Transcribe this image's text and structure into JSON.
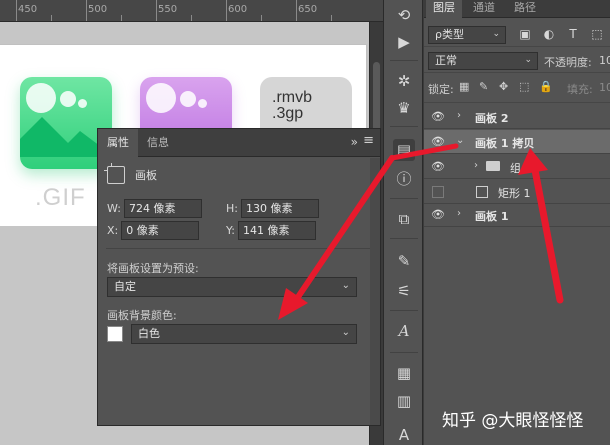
{
  "ruler": {
    "ticks": [
      "450",
      "500",
      "550",
      "600",
      "650"
    ]
  },
  "canvas": {
    "gif_label": ".GIF",
    "rmvb_line1": ".rmvb",
    "rmvb_line2": ".3gp"
  },
  "properties_panel": {
    "tabs": [
      "属性",
      "信息"
    ],
    "collapse_glyph": "»",
    "menu_glyph": "≡",
    "type_label": "画板",
    "fields": {
      "w_label": "W:",
      "w_value": "724 像素",
      "h_label": "H:",
      "h_value": "130 像素",
      "x_label": "X:",
      "x_value": "0 像素",
      "y_label": "Y:",
      "y_value": "141 像素"
    },
    "preset_label": "将画板设置为预设:",
    "preset_value": "自定",
    "bg_color_label": "画板背景颜色:",
    "bg_color_value": "白色",
    "bg_swatch_color": "#ffffff"
  },
  "layers_panel": {
    "tabs": [
      "图层",
      "通道",
      "路径"
    ],
    "filter_select": "ρ类型",
    "blend_mode": "正常",
    "opacity_label": "不透明度:",
    "opacity_value": "10",
    "lock_label": "锁定:",
    "fill_label": "填充:",
    "fill_value": "10",
    "layers": [
      {
        "name": "画板 2",
        "visible": true
      },
      {
        "name": "画板 1 拷贝",
        "visible": true,
        "selected": true
      },
      {
        "name": "组",
        "visible": true
      },
      {
        "name": "矩形 1",
        "visible": false
      },
      {
        "name": "画板 1",
        "visible": true
      }
    ]
  },
  "watermark": "知乎 @大眼怪怪怪",
  "colors": {
    "arrow": "#e8192c",
    "selected_row": "#6b6b6b"
  }
}
